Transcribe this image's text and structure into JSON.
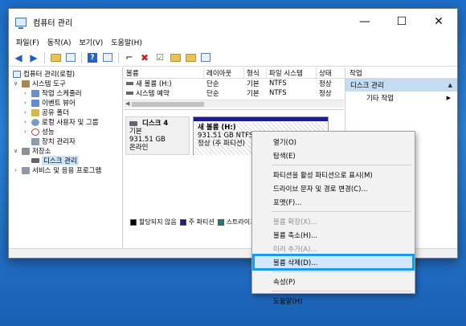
{
  "window": {
    "title": "컴퓨터 관리",
    "controls": {
      "minimize": "—",
      "maximize": "☐",
      "close": "✕"
    }
  },
  "menu": [
    "파일(F)",
    "동작(A)",
    "보기(V)",
    "도움말(H)"
  ],
  "tree": [
    {
      "label": "컴퓨터 관리(로컬)",
      "icon": "computer-icon",
      "arrow": "",
      "indent": 0
    },
    {
      "label": "시스템 도구",
      "icon": "tools-icon",
      "arrow": "∨",
      "indent": 1
    },
    {
      "label": "작업 스케줄러",
      "icon": "scheduler-icon",
      "arrow": "›",
      "indent": 2
    },
    {
      "label": "이벤트 뷰어",
      "icon": "event-viewer-icon",
      "arrow": "›",
      "indent": 2
    },
    {
      "label": "공유 폴더",
      "icon": "shared-folder-icon",
      "arrow": "›",
      "indent": 2
    },
    {
      "label": "로컬 사용자 및 그룹",
      "icon": "users-icon",
      "arrow": "›",
      "indent": 2
    },
    {
      "label": "성능",
      "icon": "performance-icon",
      "arrow": "›",
      "indent": 2
    },
    {
      "label": "장치 관리자",
      "icon": "device-manager-icon",
      "arrow": "",
      "indent": 2
    },
    {
      "label": "저장소",
      "icon": "storage-icon",
      "arrow": "∨",
      "indent": 1
    },
    {
      "label": "디스크 관리",
      "icon": "disk-icon",
      "arrow": "",
      "indent": 2
    },
    {
      "label": "서비스 및 응용 프로그램",
      "icon": "services-icon",
      "arrow": "›",
      "indent": 1
    }
  ],
  "volumes": {
    "columns": [
      "볼륨",
      "레이아웃",
      "형식",
      "파일 시스템",
      "상태"
    ],
    "rows": [
      [
        "새 볼륨 (H:)",
        "단순",
        "기본",
        "NTFS",
        "정상"
      ],
      [
        "시스템 예약",
        "단순",
        "기본",
        "NTFS",
        "정상"
      ]
    ]
  },
  "disk": {
    "name": "디스크 4",
    "type": "기본",
    "size": "931.51 GB",
    "status": "온라인",
    "partition": {
      "name": "새 볼륨  (H:)",
      "detail": "931.51 GB NTFS",
      "status": "정상 (주 파티션)"
    }
  },
  "legend": [
    "할당되지 않음",
    "주 파티션",
    "스트라이프"
  ],
  "actions": {
    "title": "작업",
    "section": "디스크 관리",
    "items": [
      "기타 작업"
    ]
  },
  "context_menu": {
    "items": [
      {
        "label": "열기(O)",
        "disabled": false
      },
      {
        "label": "탐색(E)",
        "disabled": false
      },
      {
        "sep": true
      },
      {
        "label": "파티션을 활성 파티션으로 표시(M)",
        "disabled": false
      },
      {
        "label": "드라이브 문자 및 경로 변경(C)...",
        "disabled": false
      },
      {
        "label": "포맷(F)...",
        "disabled": false
      },
      {
        "sep": true
      },
      {
        "label": "볼륨 확장(X)...",
        "disabled": true
      },
      {
        "label": "볼륨 축소(H)...",
        "disabled": false
      },
      {
        "label": "미러 추가(A)...",
        "disabled": true
      },
      {
        "label": "볼륨 삭제(D)...",
        "disabled": false,
        "highlight": true
      },
      {
        "sep": true
      },
      {
        "label": "속성(P)",
        "disabled": false
      },
      {
        "sep": true
      },
      {
        "label": "도움말(H)",
        "disabled": false
      }
    ]
  }
}
